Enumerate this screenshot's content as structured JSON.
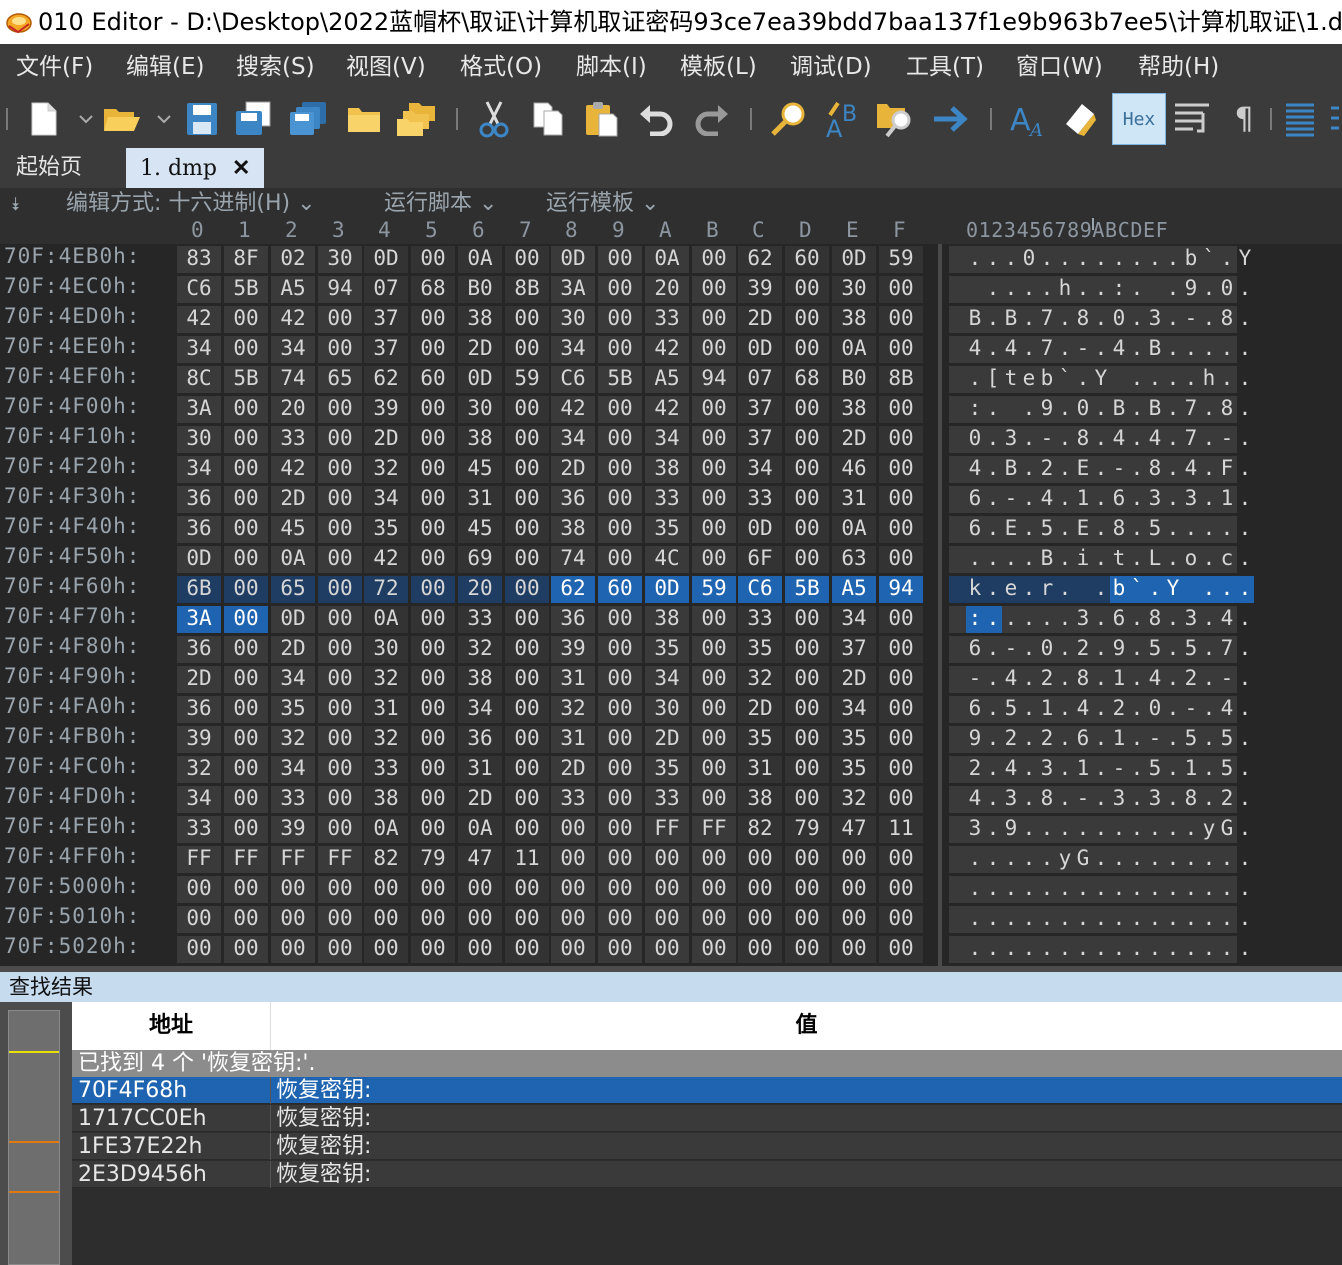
{
  "window": {
    "title": "010 Editor - D:\\Desktop\\2022蓝帽杯\\取证\\计算机取证密码93ce7ea39bdd7baa137f1e9b963b7ee5\\计算机取证\\1.dmp"
  },
  "menu": [
    "文件(F)",
    "编辑(E)",
    "搜索(S)",
    "视图(V)",
    "格式(O)",
    "脚本(I)",
    "模板(L)",
    "调试(D)",
    "工具(T)",
    "窗口(W)",
    "帮助(H)"
  ],
  "toolbar": {
    "hex_label": "Hex",
    "icons": [
      "new-file-icon",
      "open-folder-icon",
      "save-icon",
      "save-as-icon",
      "save-all-icon",
      "folder-icon",
      "open-multiple-icon",
      "cut-icon",
      "copy-icon",
      "paste-icon",
      "undo-icon",
      "redo-icon",
      "find-icon",
      "replace-icon",
      "find-in-files-icon",
      "goto-icon",
      "font-icon",
      "highlight-icon",
      "hex-mode-icon",
      "wrap-icon",
      "pilcrow-icon",
      "columns-icon"
    ]
  },
  "tabs": [
    {
      "label": "起始页",
      "active": false
    },
    {
      "label": "1. dmp",
      "active": true,
      "close": "✕"
    }
  ],
  "editor": {
    "edit_mode": "编辑方式: 十六进制(H)",
    "run_script": "运行脚本",
    "run_template": "运行模板",
    "column_labels": [
      "0",
      "1",
      "2",
      "3",
      "4",
      "5",
      "6",
      "7",
      "8",
      "9",
      "A",
      "B",
      "C",
      "D",
      "E",
      "F"
    ],
    "ascii_header": "0123456789ABCDEF"
  },
  "hex_rows": [
    {
      "addr": "70F:4EB0h:",
      "bytes": [
        "83",
        "8F",
        "02",
        "30",
        "0D",
        "00",
        "0A",
        "00",
        "0D",
        "00",
        "0A",
        "00",
        "62",
        "60",
        "0D",
        "59"
      ],
      "ascii": "...0........b`.Y"
    },
    {
      "addr": "70F:4EC0h:",
      "bytes": [
        "C6",
        "5B",
        "A5",
        "94",
        "07",
        "68",
        "B0",
        "8B",
        "3A",
        "00",
        "20",
        "00",
        "39",
        "00",
        "30",
        "00"
      ],
      "ascii": " ....h..:. .9.0."
    },
    {
      "addr": "70F:4ED0h:",
      "bytes": [
        "42",
        "00",
        "42",
        "00",
        "37",
        "00",
        "38",
        "00",
        "30",
        "00",
        "33",
        "00",
        "2D",
        "00",
        "38",
        "00"
      ],
      "ascii": "B.B.7.8.0.3.-.8."
    },
    {
      "addr": "70F:4EE0h:",
      "bytes": [
        "34",
        "00",
        "34",
        "00",
        "37",
        "00",
        "2D",
        "00",
        "34",
        "00",
        "42",
        "00",
        "0D",
        "00",
        "0A",
        "00"
      ],
      "ascii": "4.4.7.-.4.B....."
    },
    {
      "addr": "70F:4EF0h:",
      "bytes": [
        "8C",
        "5B",
        "74",
        "65",
        "62",
        "60",
        "0D",
        "59",
        "C6",
        "5B",
        "A5",
        "94",
        "07",
        "68",
        "B0",
        "8B"
      ],
      "ascii": ".[teb`.Y ....h.."
    },
    {
      "addr": "70F:4F00h:",
      "bytes": [
        "3A",
        "00",
        "20",
        "00",
        "39",
        "00",
        "30",
        "00",
        "42",
        "00",
        "42",
        "00",
        "37",
        "00",
        "38",
        "00"
      ],
      "ascii": ":. .9.0.B.B.7.8."
    },
    {
      "addr": "70F:4F10h:",
      "bytes": [
        "30",
        "00",
        "33",
        "00",
        "2D",
        "00",
        "38",
        "00",
        "34",
        "00",
        "34",
        "00",
        "37",
        "00",
        "2D",
        "00"
      ],
      "ascii": "0.3.-.8.4.4.7.-."
    },
    {
      "addr": "70F:4F20h:",
      "bytes": [
        "34",
        "00",
        "42",
        "00",
        "32",
        "00",
        "45",
        "00",
        "2D",
        "00",
        "38",
        "00",
        "34",
        "00",
        "46",
        "00"
      ],
      "ascii": "4.B.2.E.-.8.4.F."
    },
    {
      "addr": "70F:4F30h:",
      "bytes": [
        "36",
        "00",
        "2D",
        "00",
        "34",
        "00",
        "31",
        "00",
        "36",
        "00",
        "33",
        "00",
        "33",
        "00",
        "31",
        "00"
      ],
      "ascii": "6.-.4.1.6.3.3.1."
    },
    {
      "addr": "70F:4F40h:",
      "bytes": [
        "36",
        "00",
        "45",
        "00",
        "35",
        "00",
        "45",
        "00",
        "38",
        "00",
        "35",
        "00",
        "0D",
        "00",
        "0A",
        "00"
      ],
      "ascii": "6.E.5.E.8.5....."
    },
    {
      "addr": "70F:4F50h:",
      "bytes": [
        "0D",
        "00",
        "0A",
        "00",
        "42",
        "00",
        "69",
        "00",
        "74",
        "00",
        "4C",
        "00",
        "6F",
        "00",
        "63",
        "00"
      ],
      "ascii": "....B.i.t.L.o.c."
    },
    {
      "addr": "70F:4F60h:",
      "bytes": [
        "6B",
        "00",
        "65",
        "00",
        "72",
        "00",
        "20",
        "00",
        "62",
        "60",
        "0D",
        "59",
        "C6",
        "5B",
        "A5",
        "94"
      ],
      "ascii": "k.e.r. .b`.Y ...",
      "row_selected": true,
      "sel_from": 8
    },
    {
      "addr": "70F:4F70h:",
      "bytes": [
        "3A",
        "00",
        "0D",
        "00",
        "0A",
        "00",
        "33",
        "00",
        "36",
        "00",
        "38",
        "00",
        "33",
        "00",
        "34",
        "00"
      ],
      "ascii": ":.....3.6.8.3.4.",
      "sel_to": 1
    },
    {
      "addr": "70F:4F80h:",
      "bytes": [
        "36",
        "00",
        "2D",
        "00",
        "30",
        "00",
        "32",
        "00",
        "39",
        "00",
        "35",
        "00",
        "35",
        "00",
        "37",
        "00"
      ],
      "ascii": "6.-.0.2.9.5.5.7."
    },
    {
      "addr": "70F:4F90h:",
      "bytes": [
        "2D",
        "00",
        "34",
        "00",
        "32",
        "00",
        "38",
        "00",
        "31",
        "00",
        "34",
        "00",
        "32",
        "00",
        "2D",
        "00"
      ],
      "ascii": "-.4.2.8.1.4.2.-."
    },
    {
      "addr": "70F:4FA0h:",
      "bytes": [
        "36",
        "00",
        "35",
        "00",
        "31",
        "00",
        "34",
        "00",
        "32",
        "00",
        "30",
        "00",
        "2D",
        "00",
        "34",
        "00"
      ],
      "ascii": "6.5.1.4.2.0.-.4."
    },
    {
      "addr": "70F:4FB0h:",
      "bytes": [
        "39",
        "00",
        "32",
        "00",
        "32",
        "00",
        "36",
        "00",
        "31",
        "00",
        "2D",
        "00",
        "35",
        "00",
        "35",
        "00"
      ],
      "ascii": "9.2.2.6.1.-.5.5."
    },
    {
      "addr": "70F:4FC0h:",
      "bytes": [
        "32",
        "00",
        "34",
        "00",
        "33",
        "00",
        "31",
        "00",
        "2D",
        "00",
        "35",
        "00",
        "31",
        "00",
        "35",
        "00"
      ],
      "ascii": "2.4.3.1.-.5.1.5."
    },
    {
      "addr": "70F:4FD0h:",
      "bytes": [
        "34",
        "00",
        "33",
        "00",
        "38",
        "00",
        "2D",
        "00",
        "33",
        "00",
        "33",
        "00",
        "38",
        "00",
        "32",
        "00"
      ],
      "ascii": "4.3.8.-.3.3.8.2."
    },
    {
      "addr": "70F:4FE0h:",
      "bytes": [
        "33",
        "00",
        "39",
        "00",
        "0A",
        "00",
        "0A",
        "00",
        "00",
        "00",
        "FF",
        "FF",
        "82",
        "79",
        "47",
        "11"
      ],
      "ascii": "3.9..........yG."
    },
    {
      "addr": "70F:4FF0h:",
      "bytes": [
        "FF",
        "FF",
        "FF",
        "FF",
        "82",
        "79",
        "47",
        "11",
        "00",
        "00",
        "00",
        "00",
        "00",
        "00",
        "00",
        "00"
      ],
      "ascii": ".....yG........."
    },
    {
      "addr": "70F:5000h:",
      "bytes": [
        "00",
        "00",
        "00",
        "00",
        "00",
        "00",
        "00",
        "00",
        "00",
        "00",
        "00",
        "00",
        "00",
        "00",
        "00",
        "00"
      ],
      "ascii": "................"
    },
    {
      "addr": "70F:5010h:",
      "bytes": [
        "00",
        "00",
        "00",
        "00",
        "00",
        "00",
        "00",
        "00",
        "00",
        "00",
        "00",
        "00",
        "00",
        "00",
        "00",
        "00"
      ],
      "ascii": "................"
    },
    {
      "addr": "70F:5020h:",
      "bytes": [
        "00",
        "00",
        "00",
        "00",
        "00",
        "00",
        "00",
        "00",
        "00",
        "00",
        "00",
        "00",
        "00",
        "00",
        "00",
        "00"
      ],
      "ascii": "................"
    }
  ],
  "find_results": {
    "panel_title": "查找结果",
    "col_address": "地址",
    "col_value": "值",
    "summary": "已找到 4 个 '恢复密钥:'.",
    "rows": [
      {
        "address": "70F4F68h",
        "value": "恢复密钥:",
        "selected": true
      },
      {
        "address": "1717CC0Eh",
        "value": "恢复密钥:",
        "selected": false
      },
      {
        "address": "1FE37E22h",
        "value": "恢复密钥:",
        "selected": false
      },
      {
        "address": "2E3D9456h",
        "value": "恢复密钥:",
        "selected": false
      }
    ]
  },
  "colors": {
    "selection": "#1f64b0",
    "selected_row_bg": "#1f3c63",
    "map_marker_current": "#e8e000",
    "map_marker_other": "#e07a10"
  }
}
